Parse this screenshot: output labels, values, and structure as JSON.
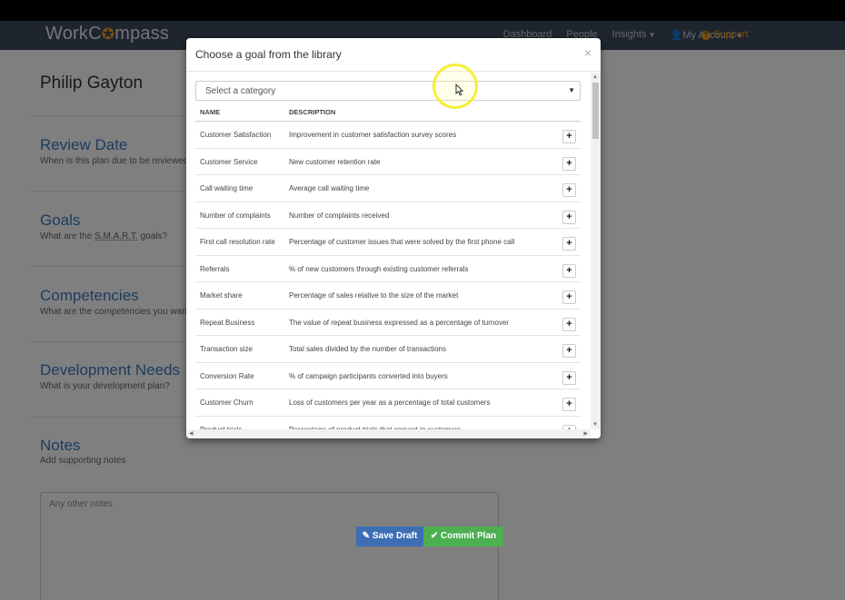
{
  "navbar": {
    "brand_prefix": "WorkC",
    "brand_suffix": "mpass",
    "dashboard": "Dashboard",
    "people": "People",
    "insights": "Insights",
    "my_account": "My Account",
    "support": "Support"
  },
  "page": {
    "person_name": "Philip Gayton",
    "sections": [
      {
        "title": "Review Date",
        "subtitle": "When is this plan due to be reviewed?"
      },
      {
        "title": "Goals",
        "subtitle_pre": "What are the ",
        "subtitle_abbr": "S.M.A.R.T.",
        "subtitle_post": " goals?"
      },
      {
        "title": "Competencies",
        "subtitle": "What are the competencies you want"
      },
      {
        "title": "Development Needs",
        "subtitle": "What is your development plan?"
      },
      {
        "title": "Notes",
        "subtitle": "Add supporting notes"
      }
    ],
    "notes_placeholder": "Any other notes",
    "save_draft": "Save Draft",
    "commit_plan": "Commit Plan"
  },
  "modal": {
    "title": "Choose a goal from the library",
    "close": "×",
    "category_placeholder": "Select a category",
    "columns": {
      "name": "NAME",
      "description": "DESCRIPTION"
    },
    "add_label": "+",
    "goals": [
      {
        "name": "Customer Satisfaction",
        "description": "Improvement in customer satisfaction survey scores"
      },
      {
        "name": "Customer Service",
        "description": "New customer retention rate"
      },
      {
        "name": "Call waiting time",
        "description": "Average call waiting time"
      },
      {
        "name": "Number of complaints",
        "description": "Number of complaints received"
      },
      {
        "name": "First call resolution rate",
        "description": "Percentage of customer issues that were solved by the first phone call"
      },
      {
        "name": "Referrals",
        "description": "% of new customers through existing customer referrals"
      },
      {
        "name": "Market share",
        "description": "Percentage of sales relative to the size of the market"
      },
      {
        "name": "Repeat Business",
        "description": "The value of repeat business expressed as a percentage of turnover"
      },
      {
        "name": "Transaction size",
        "description": "Total sales divided by the number of transactions"
      },
      {
        "name": "Conversion Rate",
        "description": "% of campaign participants converted into buyers"
      },
      {
        "name": "Customer Churn",
        "description": "Loss of customers per year as a percentage of total customers"
      },
      {
        "name": "Product trials",
        "description": "Percentage of product trials that convert in customers"
      }
    ]
  },
  "colors": {
    "navbar": "#3c4a5c",
    "accent_orange": "#f29c1f",
    "section_blue": "#3a78c2",
    "save_blue": "#3d6eb3",
    "commit_green": "#4caf50"
  }
}
